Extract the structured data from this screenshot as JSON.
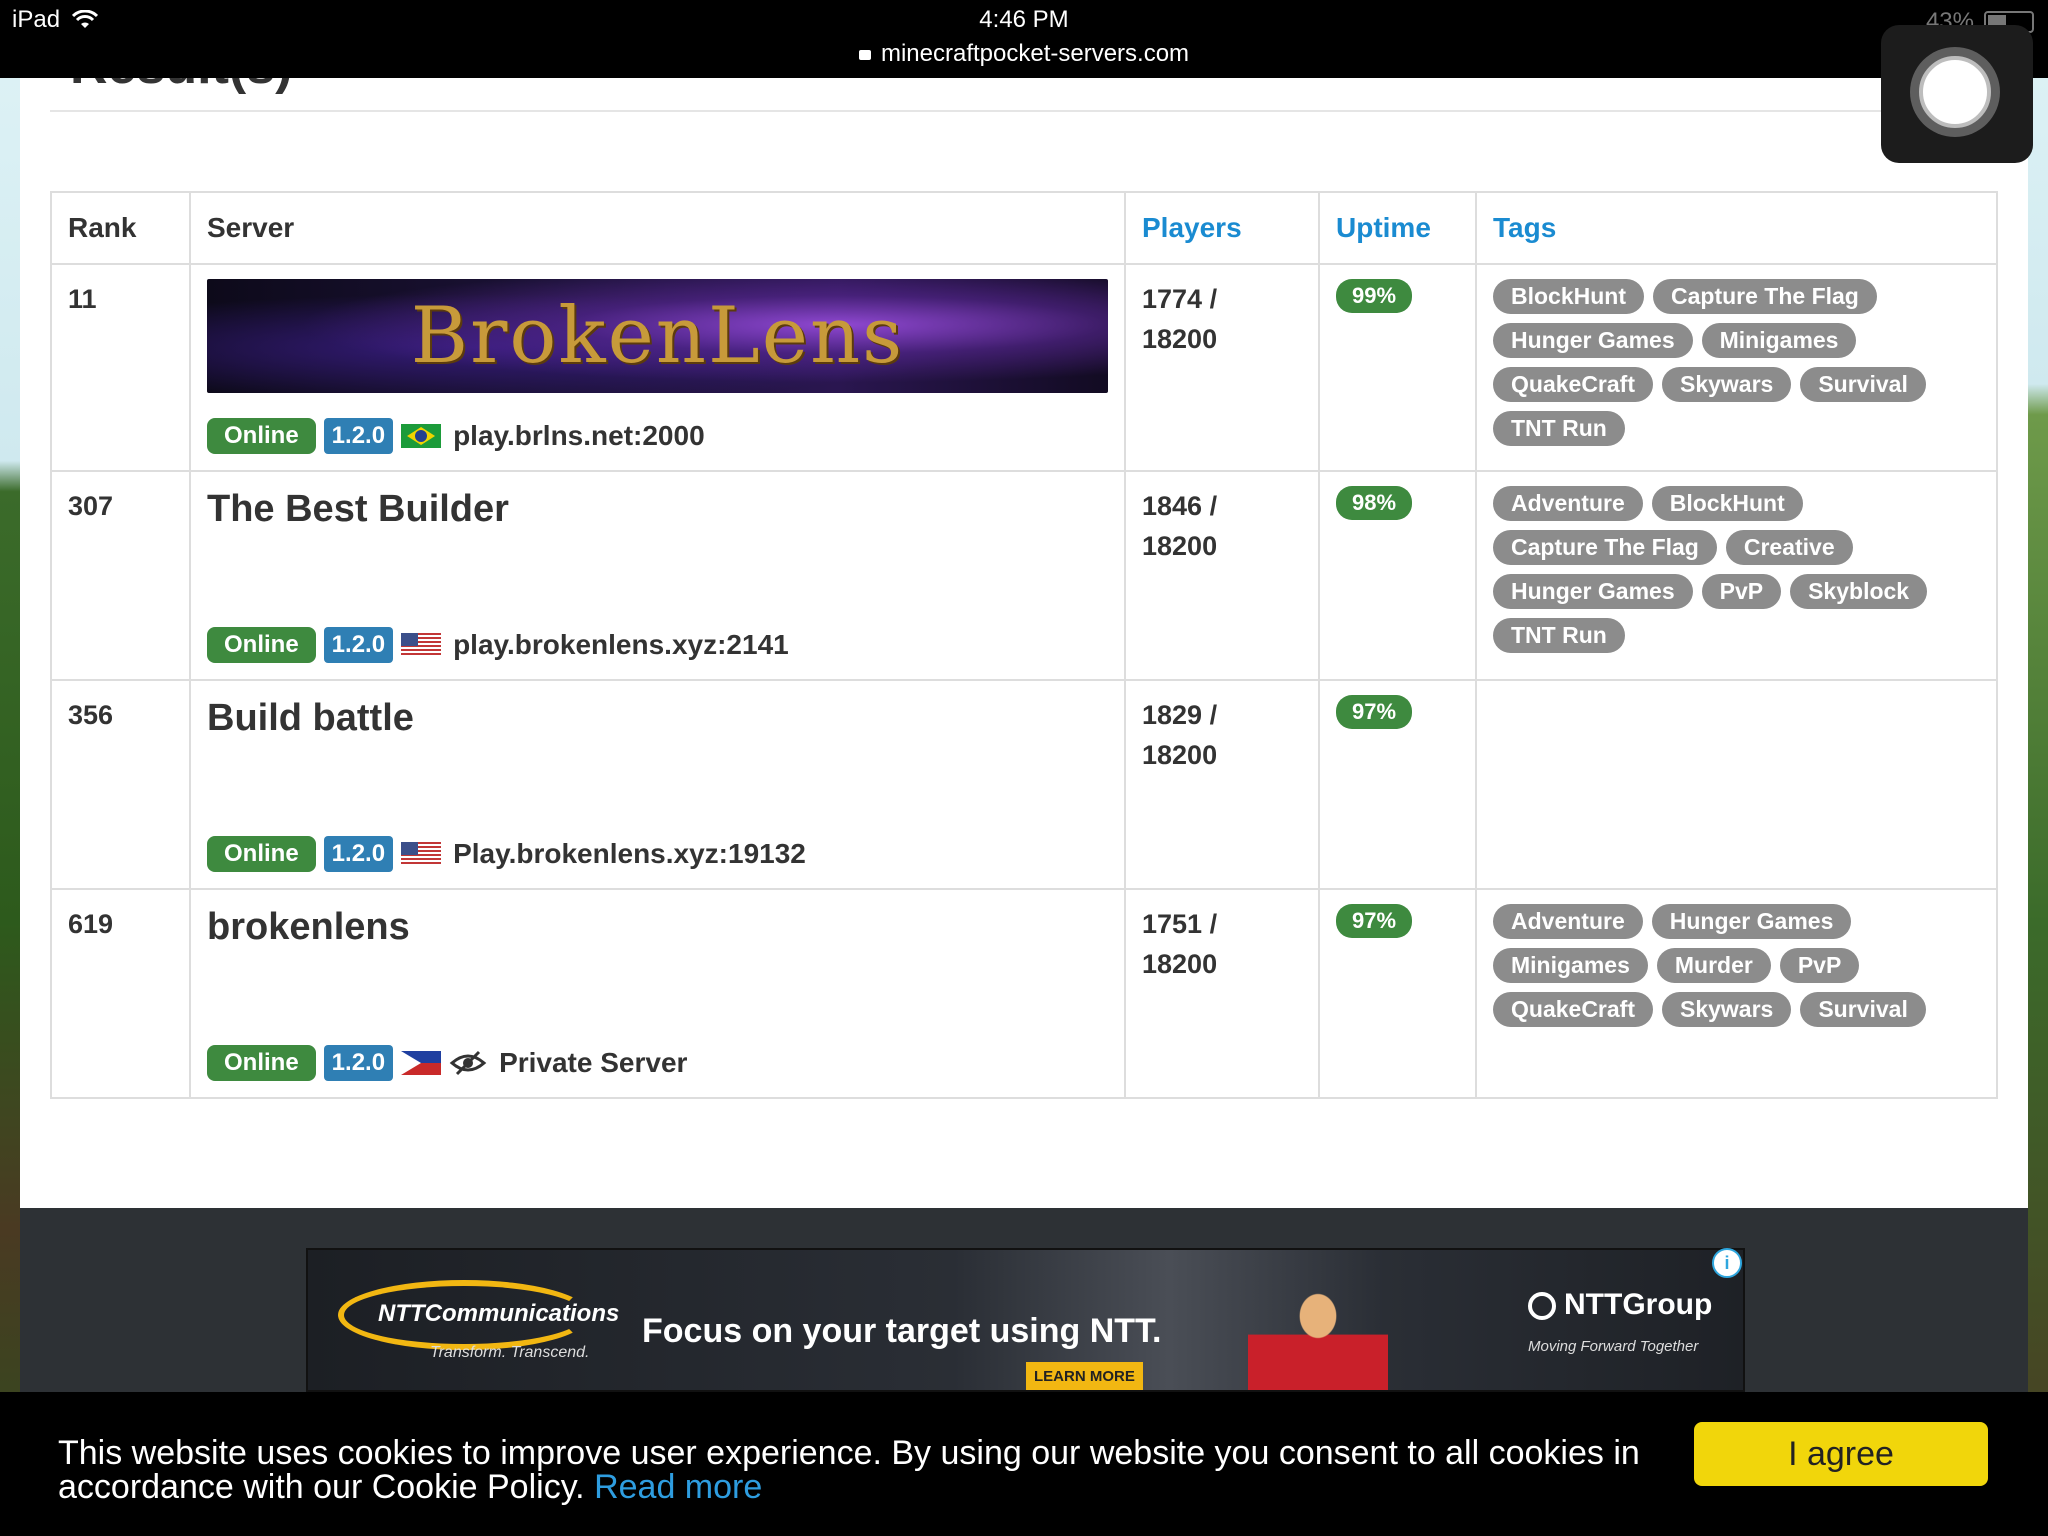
{
  "status_bar": {
    "device": "iPad",
    "time": "4:46 PM",
    "url": "minecraftpocket-servers.com",
    "battery": "43%"
  },
  "page": {
    "title": "Result(s)"
  },
  "table": {
    "headers": {
      "rank": "Rank",
      "server": "Server",
      "players": "Players",
      "uptime": "Uptime",
      "tags": "Tags"
    },
    "rows": [
      {
        "rank": "11",
        "banner_text": "BrokenLens",
        "name": "",
        "status": "Online",
        "version": "1.2.0",
        "flag": "brazil-flag",
        "address": "play.brlns.net:2000",
        "players_line1": "1774 /",
        "players_line2": "18200",
        "uptime": "99%",
        "tags": [
          "BlockHunt",
          "Capture The Flag",
          "Hunger Games",
          "Minigames",
          "QuakeCraft",
          "Skywars",
          "Survival",
          "TNT Run"
        ]
      },
      {
        "rank": "307",
        "name": "The Best Builder",
        "status": "Online",
        "version": "1.2.0",
        "flag": "usa-flag",
        "address": "play.brokenlens.xyz:2141",
        "players_line1": "1846 /",
        "players_line2": "18200",
        "uptime": "98%",
        "tags": [
          "Adventure",
          "BlockHunt",
          "Capture The Flag",
          "Creative",
          "Hunger Games",
          "PvP",
          "Skyblock",
          "TNT Run"
        ]
      },
      {
        "rank": "356",
        "name": "Build battle",
        "status": "Online",
        "version": "1.2.0",
        "flag": "usa-flag",
        "address": "Play.brokenlens.xyz:19132",
        "players_line1": "1829 /",
        "players_line2": "18200",
        "uptime": "97%",
        "tags": []
      },
      {
        "rank": "619",
        "name": "brokenlens",
        "status": "Online",
        "version": "1.2.0",
        "flag": "philippines-flag",
        "address": "Private Server",
        "players_line1": "1751 /",
        "players_line2": "18200",
        "uptime": "97%",
        "tags": [
          "Adventure",
          "Hunger Games",
          "Minigames",
          "Murder",
          "PvP",
          "QuakeCraft",
          "Skywars",
          "Survival"
        ]
      }
    ]
  },
  "ad": {
    "brand": "NTTCommunications",
    "tagline": "Transform. Transcend.",
    "headline": "Focus on your target using NTT.",
    "cta": "LEARN MORE",
    "group": "NTTGroup",
    "group_tagline": "Moving Forward Together",
    "info_icon": "i"
  },
  "cookie": {
    "text": "This website uses cookies to improve user experience. By using our website you consent to all cookies in accordance with our Cookie Policy.",
    "link": "Read more",
    "button": "I agree"
  },
  "colors": {
    "online": "#3e8a3f",
    "version": "#2f7fb4",
    "tag": "#8c8c8c",
    "link": "#1a8bd1",
    "agree": "#f1d60b"
  }
}
